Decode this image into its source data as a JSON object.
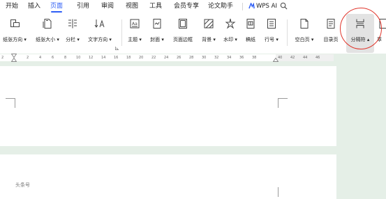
{
  "menubar": {
    "tabs": [
      {
        "label": "开始"
      },
      {
        "label": "插入"
      },
      {
        "label": "页面",
        "active": true
      },
      {
        "label": "引用"
      },
      {
        "label": "审阅"
      },
      {
        "label": "视图"
      },
      {
        "label": "工具"
      },
      {
        "label": "会员专享"
      },
      {
        "label": "论文助手"
      }
    ],
    "ai_label": "WPS AI",
    "ai_icon": "wps-ai-logo-icon",
    "search_icon": "search-icon",
    "active_color": "#2e5ef5"
  },
  "ribbon": {
    "buttons": [
      {
        "label": "纸张方向",
        "icon": "page-orientation-icon"
      },
      {
        "label": "纸张大小",
        "icon": "page-size-icon"
      },
      {
        "label": "分栏",
        "icon": "columns-icon"
      },
      {
        "label": "文字方向",
        "icon": "text-direction-icon"
      },
      {
        "label": "主题",
        "icon": "theme-icon"
      },
      {
        "label": "封面",
        "icon": "cover-icon"
      },
      {
        "label": "页面边框",
        "icon": "page-border-icon"
      },
      {
        "label": "背景",
        "icon": "background-icon"
      },
      {
        "label": "水印",
        "icon": "watermark-icon"
      },
      {
        "label": "稿纸",
        "icon": "manuscript-paper-icon"
      },
      {
        "label": "行号",
        "icon": "line-numbers-icon"
      },
      {
        "label": "空白页",
        "icon": "blank-page-icon"
      },
      {
        "label": "目录页",
        "icon": "toc-page-icon"
      },
      {
        "label": "分隔符",
        "icon": "separator-icon",
        "highlighted": true
      },
      {
        "label": "章",
        "icon": "section-icon"
      }
    ],
    "highlight_color": "#e0352b"
  },
  "ruler": {
    "ticks": [
      "2",
      "2",
      "4",
      "6",
      "8",
      "10",
      "12",
      "14",
      "16",
      "18",
      "20",
      "22",
      "24",
      "26",
      "28",
      "30",
      "32",
      "34",
      "36",
      "38",
      "40",
      "42",
      "44",
      "46"
    ]
  },
  "document": {
    "header_label": "头条号"
  }
}
